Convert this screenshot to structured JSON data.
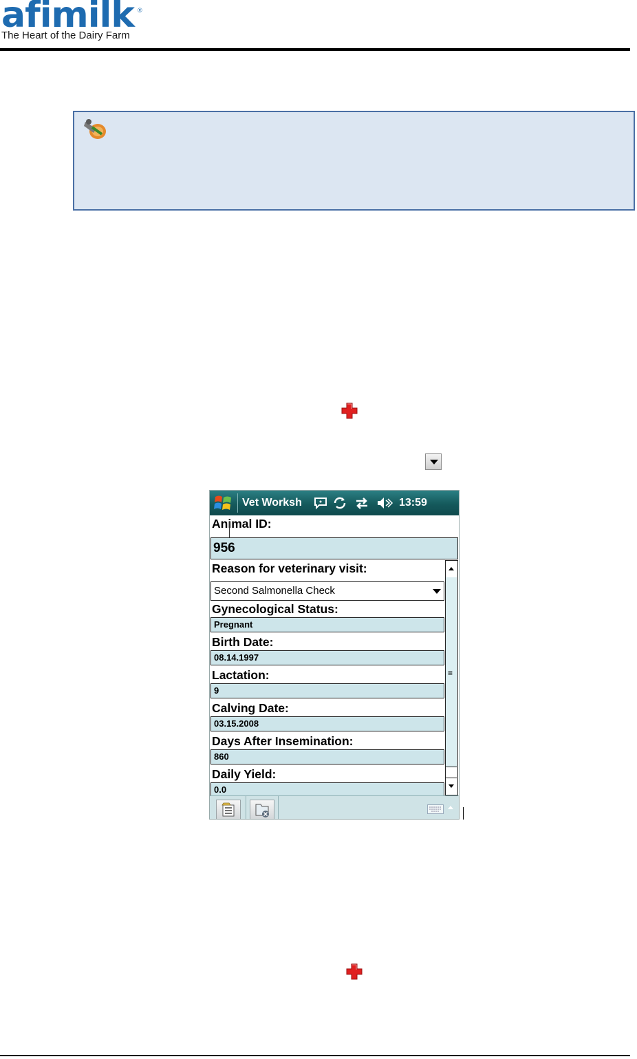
{
  "header": {
    "logo_word": "afimilk",
    "logo_registered": "®",
    "tagline": "The Heart of the Dairy Farm",
    "brand_color": "#1e6bb0"
  },
  "note": {
    "icon": "hand-pointer-note-icon",
    "background": "#dce6f2",
    "border": "#4a6fa5"
  },
  "icons": {
    "first_cross": "red-cross-icon",
    "dropdown": "dropdown-arrow-icon",
    "second_cross": "red-cross-icon"
  },
  "device": {
    "titlebar": {
      "title": "Vet Worksh",
      "time": "13:59",
      "icons": [
        "windows-start-icon",
        "chat-bubble-icon",
        "sync-icon",
        "connectivity-arrows-icon",
        "speaker-icon"
      ]
    },
    "animal_id": {
      "label": "Animal ID:",
      "value": "956"
    },
    "reason": {
      "label": "Reason for veterinary visit:",
      "selected": "Second Salmonella Check"
    },
    "fields": [
      {
        "label": "Gynecological Status:",
        "value": "Pregnant"
      },
      {
        "label": "Birth Date:",
        "value": "08.14.1997"
      },
      {
        "label": "Lactation:",
        "value": "9"
      },
      {
        "label": "Calving Date:",
        "value": "03.15.2008"
      },
      {
        "label": "Days After Insemination:",
        "value": "860"
      },
      {
        "label": "Daily Yield:",
        "value": "0.0"
      }
    ],
    "bottombar": {
      "buttons": [
        "menu-list-icon",
        "folder-close-icon"
      ],
      "keyboard": "keyboard-icon"
    }
  }
}
